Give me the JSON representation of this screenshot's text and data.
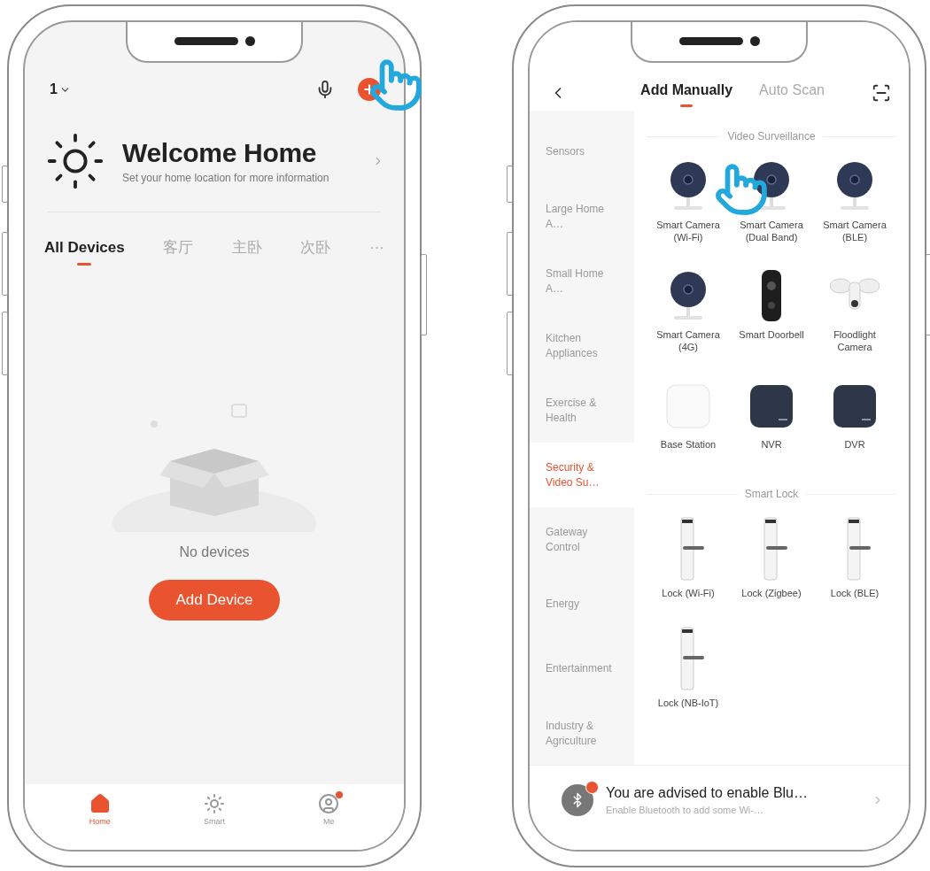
{
  "home_screen": {
    "home_selector": "1",
    "title": "Welcome Home",
    "subtitle": "Set your home location for more information",
    "room_tabs": [
      {
        "label": "All Devices",
        "selected": true
      },
      {
        "label": "客厅",
        "selected": false
      },
      {
        "label": "主卧",
        "selected": false
      },
      {
        "label": "次卧",
        "selected": false
      }
    ],
    "more": "···",
    "empty_message": "No devices",
    "add_button": "Add Device",
    "bottom_nav": [
      {
        "label": "Home",
        "kind": "home",
        "selected": true,
        "badge": false
      },
      {
        "label": "Smart",
        "kind": "smart",
        "selected": false,
        "badge": false
      },
      {
        "label": "Me",
        "kind": "me",
        "selected": false,
        "badge": true
      }
    ]
  },
  "add_device_screen": {
    "tabs": [
      {
        "label": "Add Manually",
        "selected": true
      },
      {
        "label": "Auto Scan",
        "selected": false
      }
    ],
    "categories": [
      {
        "label": "Sensors",
        "selected": false
      },
      {
        "label": "Large Home A…",
        "selected": false
      },
      {
        "label": "Small Home A…",
        "selected": false
      },
      {
        "label": "Kitchen Appliances",
        "selected": false
      },
      {
        "label": "Exercise & Health",
        "selected": false
      },
      {
        "label": "Security & Video Su…",
        "selected": true
      },
      {
        "label": "Gateway Control",
        "selected": false
      },
      {
        "label": "Energy",
        "selected": false
      },
      {
        "label": "Entertainment",
        "selected": false
      },
      {
        "label": "Industry & Agriculture",
        "selected": false
      }
    ],
    "sections": [
      {
        "title": "Video Surveillance",
        "devices": [
          {
            "name": "Smart Camera (Wi-Fi)",
            "kind": "camera"
          },
          {
            "name": "Smart Camera (Dual Band)",
            "kind": "camera"
          },
          {
            "name": "Smart Camera (BLE)",
            "kind": "camera"
          },
          {
            "name": "Smart Camera (4G)",
            "kind": "camera"
          },
          {
            "name": "Smart Doorbell",
            "kind": "doorbell"
          },
          {
            "name": "Floodlight Camera",
            "kind": "floodlight"
          },
          {
            "name": "Base Station",
            "kind": "base"
          },
          {
            "name": "NVR",
            "kind": "recorder"
          },
          {
            "name": "DVR",
            "kind": "recorder"
          }
        ]
      },
      {
        "title": "Smart Lock",
        "devices": [
          {
            "name": "Lock (Wi-Fi)",
            "kind": "lock"
          },
          {
            "name": "Lock (Zigbee)",
            "kind": "lock"
          },
          {
            "name": "Lock (BLE)",
            "kind": "lock"
          },
          {
            "name": "Lock (NB-IoT)",
            "kind": "lock"
          }
        ]
      }
    ],
    "banner": {
      "title": "You are advised to enable Blu…",
      "subtitle": "Enable Bluetooth to add some Wi-…"
    }
  }
}
